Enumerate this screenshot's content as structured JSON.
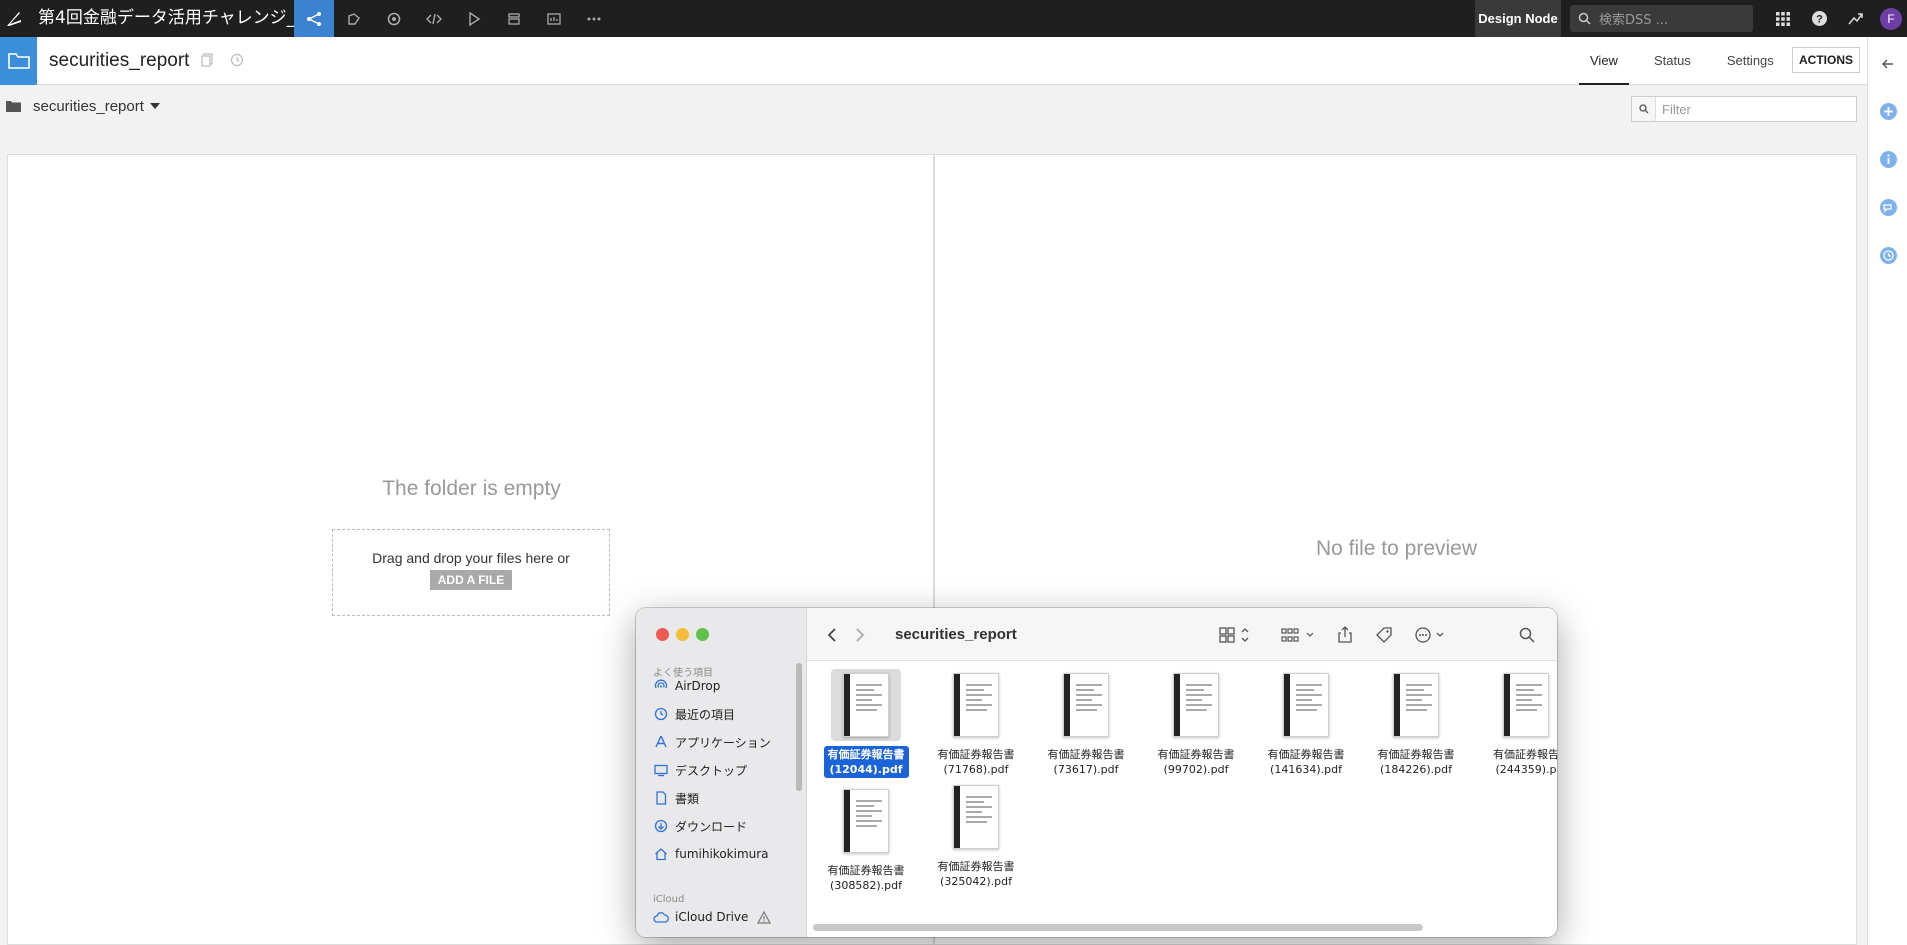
{
  "app": {
    "project_title": "第4回金融データ活用チャレンジ_",
    "design_node": "Design Node",
    "search_placeholder": "検索DSS ...",
    "avatar_initial": "F"
  },
  "header": {
    "title": "securities_report",
    "tabs": [
      "View",
      "Status",
      "Settings"
    ],
    "actions_label": "ACTIONS"
  },
  "breadcrumb": {
    "folder_label": "securities_report",
    "filter_placeholder": "Filter"
  },
  "left_panel": {
    "empty_message": "The folder is empty",
    "drop_text": "Drag and drop your files here or",
    "add_file_label": "ADD A FILE"
  },
  "right_panel": {
    "no_preview": "No file to preview"
  },
  "finder": {
    "title": "securities_report",
    "sidebar": {
      "favorites_label": "よく使う項目",
      "favorites": [
        {
          "label": "AirDrop",
          "icon": "airdrop-icon"
        },
        {
          "label": "最近の項目",
          "icon": "clock-icon"
        },
        {
          "label": "アプリケーション",
          "icon": "applications-icon"
        },
        {
          "label": "デスクトップ",
          "icon": "desktop-icon"
        },
        {
          "label": "書類",
          "icon": "document-icon"
        },
        {
          "label": "ダウンロード",
          "icon": "download-icon"
        },
        {
          "label": "fumihikokimura",
          "icon": "home-icon"
        }
      ],
      "icloud_label": "iCloud",
      "icloud_items": [
        {
          "label": "iCloud Drive",
          "icon": "cloud-icon"
        }
      ]
    },
    "files": [
      {
        "line1": "有価証券報告書",
        "line2": "(12044).pdf",
        "selected": true
      },
      {
        "line1": "有価証券報告書",
        "line2": "(71768).pdf",
        "selected": false
      },
      {
        "line1": "有価証券報告書",
        "line2": "(73617).pdf",
        "selected": false
      },
      {
        "line1": "有価証券報告書",
        "line2": "(99702).pdf",
        "selected": false
      },
      {
        "line1": "有価証券報告書",
        "line2": "(141634).pdf",
        "selected": false
      },
      {
        "line1": "有価証券報告書",
        "line2": "(184226).pdf",
        "selected": false
      },
      {
        "line1": "有価証券報告",
        "line2": "(244359).p",
        "selected": false
      },
      {
        "line1": "有価証券報告書",
        "line2": "(308582).pdf",
        "selected": false
      },
      {
        "line1": "有価証券報告書",
        "line2": "(325042).pdf",
        "selected": false
      }
    ]
  },
  "colors": {
    "accent": "#3b82d0",
    "selection": "#1a63d8",
    "topbar": "#1f1f1f"
  }
}
